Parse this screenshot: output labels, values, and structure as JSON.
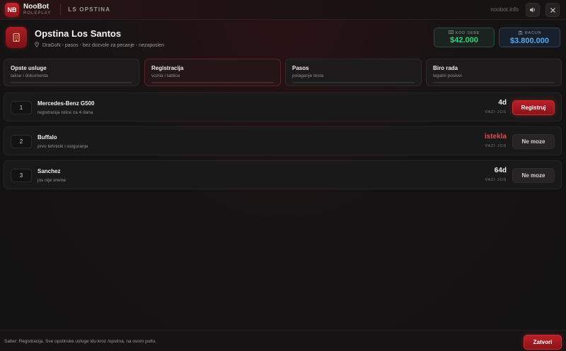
{
  "topbar": {
    "logo": "NB",
    "brand_name": "NooBot",
    "brand_sub": "ROLEPLAY",
    "section": "LS OPSTINA",
    "site": "noobot.info",
    "sound_icon": "speaker-icon",
    "close_icon": "close-icon"
  },
  "header": {
    "icon": "building-icon",
    "title": "Opstina Los Santos",
    "subtitle": "DraGoN - pasos - bez dozvole za pecanje - nezaposlen"
  },
  "money": {
    "cash": {
      "label": "KOD SEBE",
      "value": "$42.000",
      "icon": "cash-icon",
      "color": "#36d07e"
    },
    "bank": {
      "label": "RACUN",
      "value": "$3.800.000",
      "icon": "bank-icon",
      "color": "#54a8f0"
    }
  },
  "tabs": [
    {
      "title": "Opste usluge",
      "sub": "takse i dokumenta",
      "active": false
    },
    {
      "title": "Registracija",
      "sub": "vozila i tablice",
      "active": true
    },
    {
      "title": "Pasos",
      "sub": "polaganje testa",
      "active": false
    },
    {
      "title": "Biro rada",
      "sub": "legalni poslovi",
      "active": false
    }
  ],
  "rows": [
    {
      "num": "1",
      "name": "Mercedes-Benz G500",
      "desc": "registracija istice za 4 dana",
      "status": "4d",
      "status_label": "VAZI JOS",
      "button": "Registruj"
    },
    {
      "num": "2",
      "name": "Buffalo",
      "desc": "prvo tehnicki i osiguranje",
      "status": "istekla",
      "status_label": "VAZI JOS",
      "button": "Ne moze"
    },
    {
      "num": "3",
      "name": "Sanchez",
      "desc": "jos nije vreme",
      "status": "64d",
      "status_label": "VAZI JOS",
      "button": "Ne moze"
    }
  ],
  "footer": {
    "text": "Salter: Registracija. Sve opstinske usluge idu kroz /opstina, na ovom pultu.",
    "close_label": "Zatvori"
  },
  "colors": {
    "accent": "#b91f26",
    "expired": "#e04a4f"
  }
}
